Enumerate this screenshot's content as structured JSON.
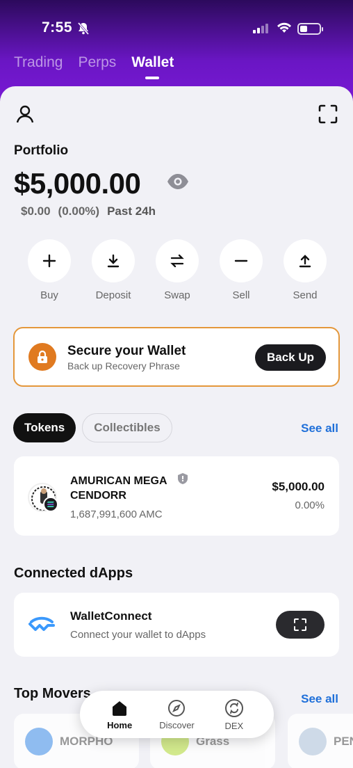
{
  "status_bar": {
    "time": "7:55"
  },
  "top_tabs": [
    {
      "label": "Trading",
      "active": false
    },
    {
      "label": "Perps",
      "active": false
    },
    {
      "label": "Wallet",
      "active": true
    }
  ],
  "portfolio": {
    "label": "Portfolio",
    "balance": "$5,000.00",
    "change_value": "$0.00",
    "change_pct": "(0.00%)",
    "period": "Past 24h"
  },
  "actions": [
    {
      "label": "Buy",
      "icon": "plus-icon"
    },
    {
      "label": "Deposit",
      "icon": "download-icon"
    },
    {
      "label": "Swap",
      "icon": "swap-icon"
    },
    {
      "label": "Sell",
      "icon": "minus-icon"
    },
    {
      "label": "Send",
      "icon": "upload-icon"
    }
  ],
  "secure_banner": {
    "title": "Secure your Wallet",
    "subtitle": "Back up Recovery Phrase",
    "button": "Back Up",
    "accent_color": "#e07a20"
  },
  "asset_tabs": {
    "tokens": "Tokens",
    "collectibles": "Collectibles",
    "see_all": "See all"
  },
  "tokens": [
    {
      "name": "AMURICAN MEGA CENDORR",
      "amount": "1,687,991,600 AMC",
      "value": "$5,000.00",
      "change": "0.00%"
    }
  ],
  "dapps": {
    "title": "Connected dApps",
    "item": {
      "name": "WalletConnect",
      "description": "Connect your wallet to dApps"
    }
  },
  "top_movers": {
    "title": "Top Movers",
    "see_all": "See all",
    "items": [
      "MORPHO",
      "Grass",
      "PEN"
    ]
  },
  "bottom_nav": [
    {
      "label": "Home",
      "active": true
    },
    {
      "label": "Discover",
      "active": false
    },
    {
      "label": "DEX",
      "active": false
    }
  ],
  "colors": {
    "link": "#1e6fd9",
    "header_purple": "#7c1ad8",
    "sheet_bg": "#f1f1f6"
  }
}
